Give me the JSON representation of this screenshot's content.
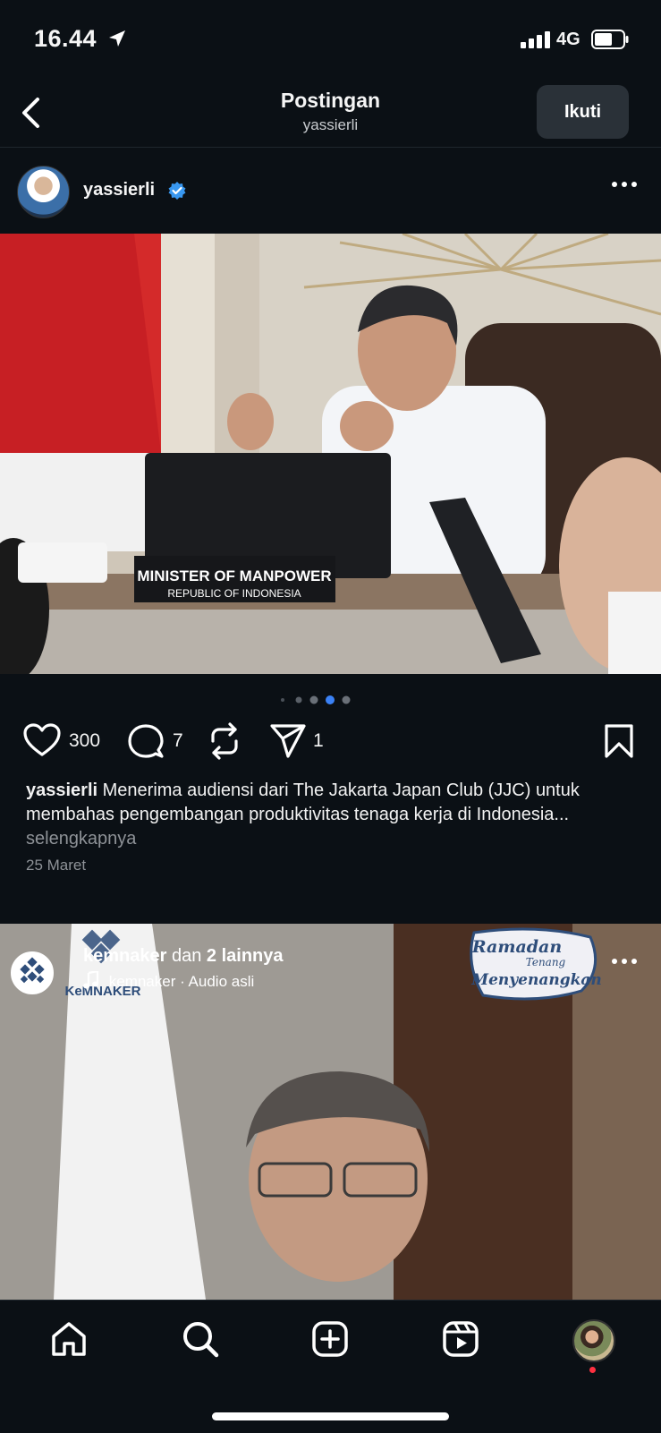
{
  "status": {
    "time": "16.44",
    "network": "4G"
  },
  "header": {
    "title": "Postingan",
    "subtitle": "yassierli",
    "follow_label": "Ikuti"
  },
  "post": {
    "username": "yassierli",
    "image_sign_title": "MINISTER OF MANPOWER",
    "image_sign_subtitle": "REPUBLIC OF INDONESIA",
    "likes": "300",
    "comments": "7",
    "shares": "1",
    "caption_user": "yassierli",
    "caption_text": "Menerima audiensi dari The Jakarta Japan Club (JJC) untuk membahas pengembangan produktivitas tenaga kerja di Indonesia...",
    "caption_more": "selengkapnya",
    "date": "25 Maret",
    "carousel_total": 4,
    "carousel_active": 3
  },
  "reel": {
    "user": "kemnaker",
    "others_prefix": "dan",
    "others": "2 lainnya",
    "audio_user": "kemnaker",
    "audio_label": "· Audio asli",
    "overlay_logo_text": "KeMNAKER",
    "overlay_banner_1": "Ramadan",
    "overlay_banner_2": "Tenang",
    "overlay_banner_3": "Menyenangkan"
  },
  "tabs": [
    "home-icon",
    "search-icon",
    "create-icon",
    "reels-icon",
    "profile-avatar"
  ],
  "colors": {
    "background": "#0b1015",
    "verified": "#3897f0",
    "accent_dot": "#3b82f6",
    "notif": "#ff3040"
  }
}
